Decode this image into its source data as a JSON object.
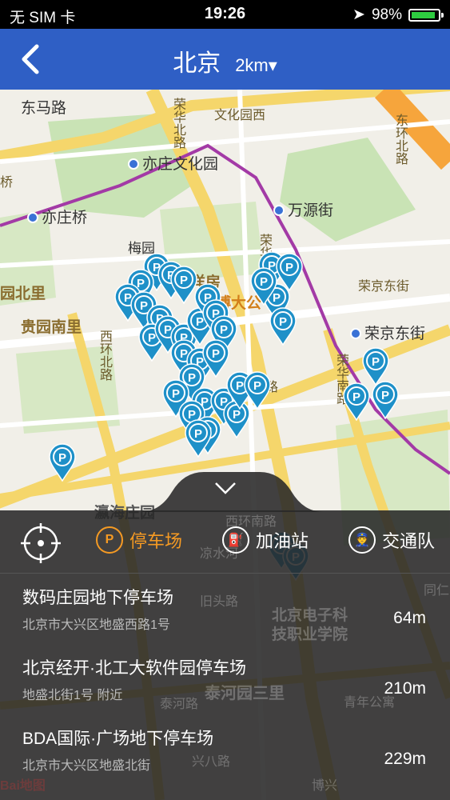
{
  "status": {
    "carrier": "无 SIM 卡",
    "time": "19:26",
    "battery": "98%",
    "battery_level": 0.98
  },
  "nav": {
    "title": "北京",
    "radius": "2km",
    "dropdown_glyph": "▾"
  },
  "map_labels": {
    "dongmalu": "东马路",
    "yizhuang_culture_park": "亦庄文化园",
    "yizhuang_bridge": "亦庄桥",
    "wanyuan_street": "万源街",
    "meiyuan": "梅园",
    "yidong_yangfang": "一栋洋房",
    "boda_park": "博大公",
    "guiyuan_north": "园北里",
    "guiyuan_south": "贵园南里",
    "rongjing_east": "荣京东街",
    "rongjing_east_station": "荣京东街",
    "wenhua_park_road": "文化园西",
    "rongda_north": "荣华北路",
    "rongda_middle": "荣华中",
    "rongda_south": "荣华南路",
    "xihuan_north": "西环北路",
    "dongfang_road": "东环北路",
    "qiao": "桥",
    "kexing": "科西路",
    "yinghai": "瀛海庄园",
    "xihuan_south": "西环南路",
    "liangshui": "凉水河",
    "jiuxiang": "旧头路",
    "tonghua": "同仁",
    "beijing_college_1": "北京电子科",
    "beijing_college_2": "技职业学院",
    "taihe_sanli": "泰河园三里",
    "taihe_road": "泰河路",
    "qingnian": "青年公寓",
    "kexing_road": "兴八路",
    "bohe": "博兴",
    "baidu_logo": "Bai地图"
  },
  "overlay": {
    "tabs": [
      {
        "icon": "P",
        "label": "停车场",
        "active": true
      },
      {
        "icon": "⛽",
        "label": "加油站",
        "active": false
      },
      {
        "icon": "👮",
        "label": "交通队",
        "active": false
      }
    ],
    "items": [
      {
        "name": "数码庄园地下停车场",
        "address": "北京市大兴区地盛西路1号",
        "distance": "64m"
      },
      {
        "name": "北京经开·北工大软件园停车场",
        "address": "地盛北街1号 附近",
        "distance": "210m"
      },
      {
        "name": "BDA国际·广场地下停车场",
        "address": "北京市大兴区地盛北街",
        "distance": "229m"
      }
    ]
  },
  "colors": {
    "nav": "#2f5fc5",
    "accent": "#f59a23",
    "pin": "#1e90c8",
    "metro": "#a33aa6"
  }
}
